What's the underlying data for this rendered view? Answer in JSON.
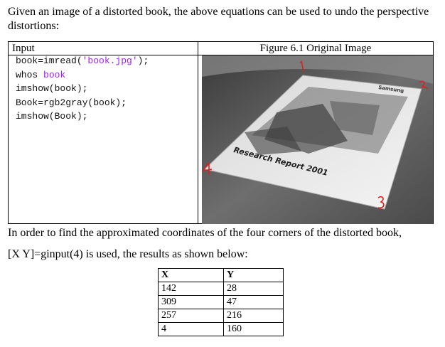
{
  "intro_text": "Given an image of a distorted book, the above equations can be used to undo the perspective distortions:",
  "table1": {
    "input_label": "Input",
    "figure_label": "Figure 6.1 Original Image",
    "code_lines": [
      {
        "text": "book=imread(",
        "string": "'book.jpg'",
        "tail": ");"
      },
      {
        "text": "whos ",
        "keyword": "book"
      },
      {
        "text": "imshow(book);"
      },
      {
        "text": "Book=rgb2gray(book);"
      },
      {
        "text": "imshow(Book);"
      }
    ]
  },
  "figure": {
    "book_title": "Research Report 2001",
    "brand": "Samsung",
    "corner_labels": [
      "1",
      "2",
      "3",
      "4"
    ],
    "annotation_color": "#e02020"
  },
  "after_text_1": "In order to find the approximated coordinates of the four corners of the distorted book,",
  "after_text_2": "[X Y]=ginput(4) is used, the results as shown below:",
  "coords_table": {
    "headers": [
      "X",
      "Y"
    ],
    "rows": [
      [
        "142",
        "28"
      ],
      [
        "309",
        "47"
      ],
      [
        "257",
        "216"
      ],
      [
        "4",
        "160"
      ]
    ]
  }
}
